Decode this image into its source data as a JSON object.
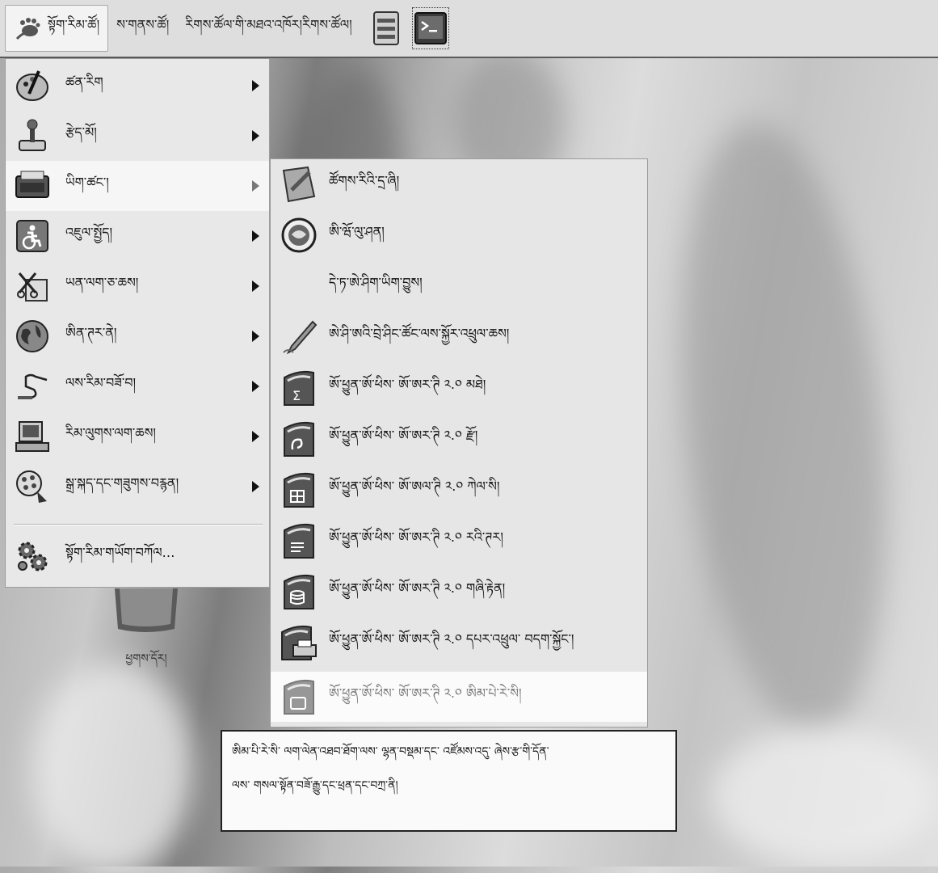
{
  "panel": {
    "applications_label": "སྟོག་རིམ་ཚོ།",
    "places_label": "ས་གནས་ཚོ།",
    "system_label": "རིགས་ཚོལ་གི་མཐའ་འཁོར།རིགས་ཚོལ།"
  },
  "menu": {
    "items": [
      {
        "label": "ཚན་རིག",
        "icon": "graphics-icon"
      },
      {
        "label": "རྩེད་མོ།",
        "icon": "games-icon"
      },
      {
        "label": "ཡིག་ཚང་།",
        "icon": "office-icon"
      },
      {
        "label": "འཇུལ་སྤྱོད།",
        "icon": "accessibility-icon"
      },
      {
        "label": "ཡན་ལག་ཅ་ཆས།",
        "icon": "accessories-icon"
      },
      {
        "label": "ཨིན་ཊར་ནེ།",
        "icon": "internet-icon"
      },
      {
        "label": "ལས་རིམ་བཟོ་བ།",
        "icon": "programming-icon"
      },
      {
        "label": "རིམ་ལུགས་ལག་ཆས།",
        "icon": "system-tools-icon"
      },
      {
        "label": "སྒྲ་སྐད་དང་གཟུགས་བརྙན།",
        "icon": "sound-video-icon"
      }
    ],
    "configure_label": "སྟོག་རིམ་གཡོག་བཀོལ…"
  },
  "submenu": {
    "items": [
      {
        "label": "ཚོགས་རིའི་དྲ་ཞི།",
        "icon": "dictionary-icon"
      },
      {
        "label": "ཨི་ཝོ་ལུ་ཤན།",
        "icon": "evolution-icon"
      },
      {
        "label": "དེ་ཏ་ཨེ་ཤིག་ཡིག་བྱུས།",
        "icon": ""
      },
      {
        "label": "ཨེ་ཤི་ཨའི་བྲེ་ཤིང་ཚོང་ལས་སྐྱོར་འཕྲུལ་ཆས།",
        "icon": "handwriting-icon"
      },
      {
        "label": "ཨོ་ཕྱུན་ཨོ་ཕིས་ ཨོ་ཨར་ཊི ༢.༠ མཐེ།",
        "icon": "ooo-math-icon"
      },
      {
        "label": "ཨོ་ཕྱུན་ཨོ་ཕིས་ ཨོ་ཨར་ཊི ༢.༠ རྫོ།",
        "icon": "ooo-draw-icon"
      },
      {
        "label": "ཨོ་ཕྱུན་ཨོ་ཕིས་ ཨོ་ཨལ་ཊི ༢.༠ ཀེལ་སི།",
        "icon": "ooo-calc-icon"
      },
      {
        "label": "ཨོ་ཕྱུན་ཨོ་ཕིས་ ཨོ་ཨར་ཊི ༢.༠ རའི་ཊར།",
        "icon": "ooo-writer-icon"
      },
      {
        "label": "ཨོ་ཕྱུན་ཨོ་ཕིས་ ཨོ་ཨར་ཊི ༢.༠ གཞི་རྟེན།",
        "icon": "ooo-base-icon"
      },
      {
        "label": "ཨོ་ཕྱུན་ཨོ་ཕིས་ ཨོ་ཨར་ཊི ༢.༠ དཔར་འཕྲུལ་ བདག་སྐྱོང་།",
        "icon": "ooo-printer-icon"
      },
      {
        "label": "ཨོ་ཕྱུན་ཨོ་ཕིས་ ཨོ་ཨར་ཊི ༢.༠ ཨིམ་པེ་རེ་སི།",
        "icon": "ooo-impress-icon"
      }
    ]
  },
  "desktop": {
    "trash_label": "ཕྱགས་དོར།"
  },
  "tooltip": {
    "line1": "ཨིམ་པི་རེ་སི་ ལག་ལེན་འཐབ་ཐོག་ལས་ ལྷན་བསྡམ་དང་ འཛོམས་འདུ་ ཞེས་རྩ་གི་དོན་",
    "line2": "ལས་ གསལ་སྟོན་བཟོ་རྒྱུ་དང་ཕྲན་དང་བཀྲ་ནི།"
  }
}
